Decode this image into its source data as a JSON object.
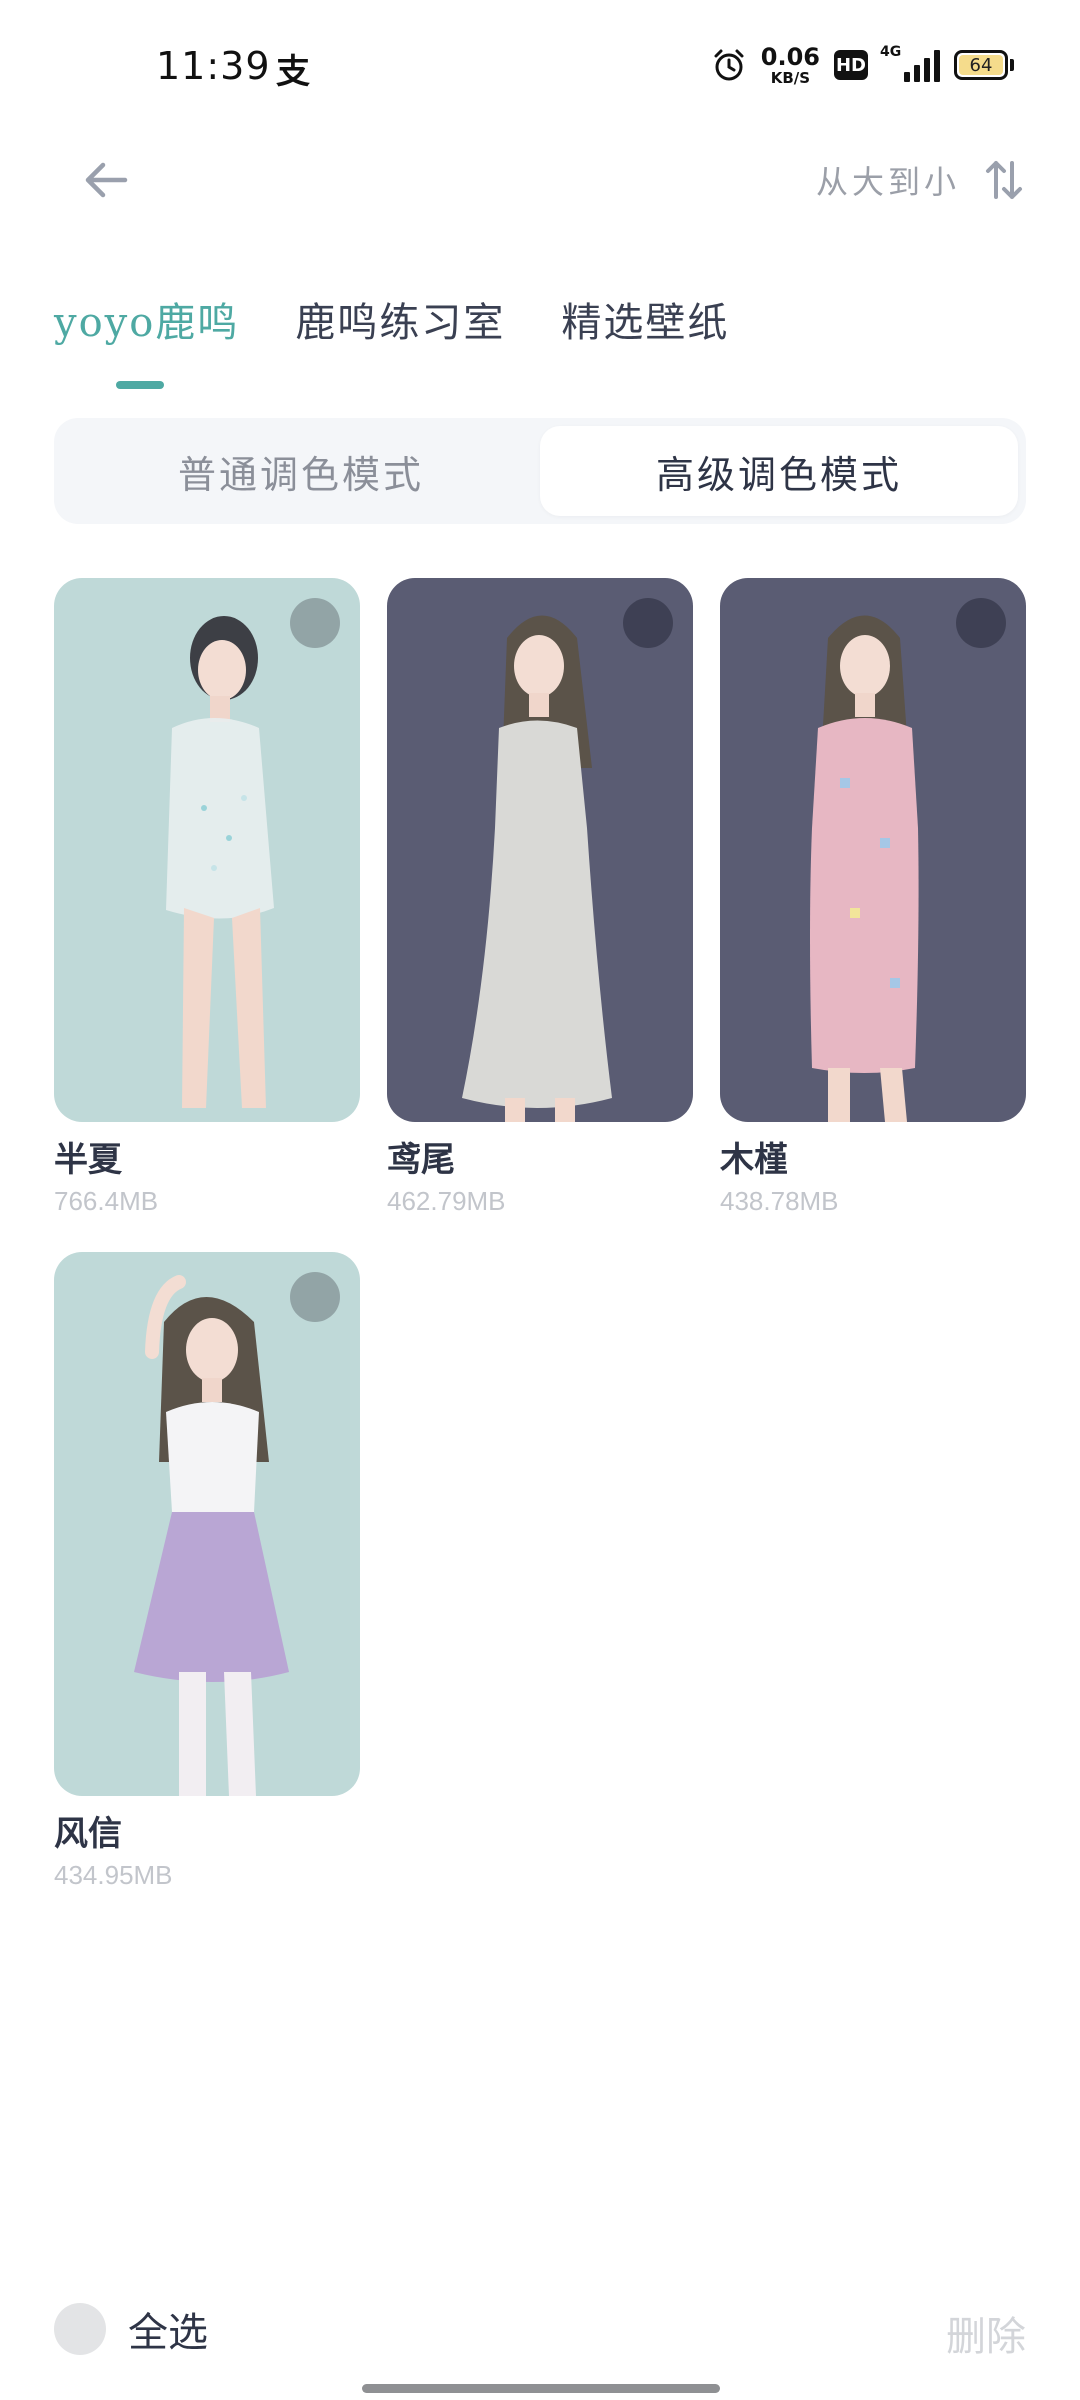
{
  "status_bar": {
    "time": "11:39",
    "app_icon_glyph": "支",
    "net_speed_value": "0.06",
    "net_speed_unit": "KB/S",
    "hd_label": "HD",
    "network_label": "4G",
    "battery_level": "64"
  },
  "header": {
    "back_icon": "arrow-left-icon",
    "sort_label": "从大到小",
    "sort_icon": "sort-arrows-icon"
  },
  "tabs": [
    {
      "label": "yoyo鹿鸣",
      "active": true
    },
    {
      "label": "鹿鸣练习室",
      "active": false
    },
    {
      "label": "精选壁纸",
      "active": false
    }
  ],
  "mode_switch": {
    "options": [
      "普通调色模式",
      "高级调色模式"
    ],
    "selected": "高级调色模式"
  },
  "items": [
    {
      "name": "半夏",
      "size": "766.4MB",
      "bg": "#bfd9d8",
      "outfit": "#e8eef0"
    },
    {
      "name": "鸢尾",
      "size": "462.79MB",
      "bg": "#5a5c73",
      "outfit": "#d9d9d6"
    },
    {
      "name": "木槿",
      "size": "438.78MB",
      "bg": "#5a5c73",
      "outfit": "#e7b7c3"
    },
    {
      "name": "风信",
      "size": "434.95MB",
      "bg": "#bfd9d8",
      "outfit": "#b9a6d4"
    }
  ],
  "footer": {
    "select_all_label": "全选",
    "delete_label": "删除"
  },
  "colors": {
    "accent": "#4ea9a3",
    "text_primary": "#2e3446",
    "text_muted": "#c2c5cb"
  }
}
